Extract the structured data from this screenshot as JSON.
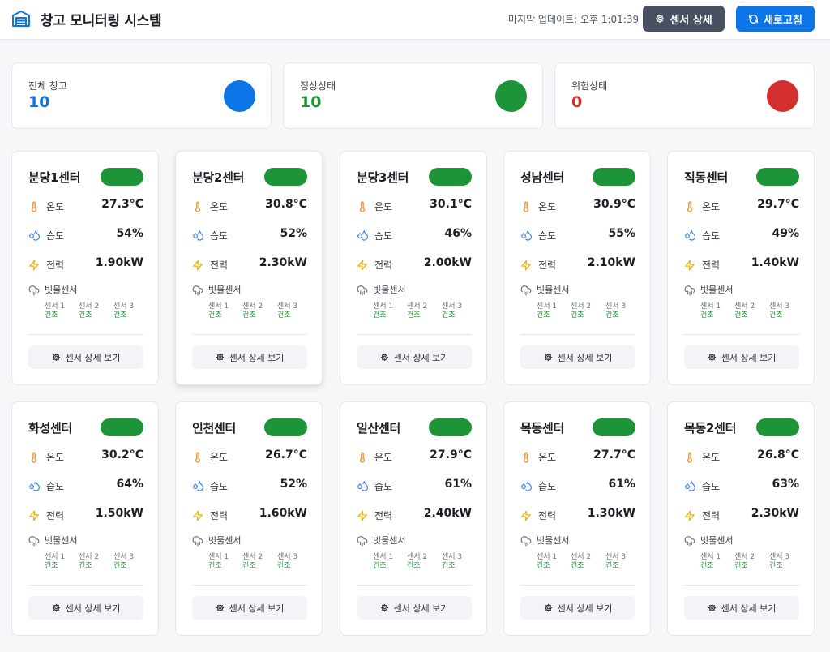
{
  "header": {
    "title": "창고 모니터링 시스템",
    "last_update": "마지막 업데이트: 오후 1:01:39",
    "sensor_detail_label": "센서 상세",
    "refresh_label": "새로고침",
    "icons": {
      "logo": "warehouse-icon",
      "sensor_detail": "gear-icon",
      "refresh": "refresh-icon"
    }
  },
  "stats": [
    {
      "label": "전체 창고",
      "value": "10",
      "color": "#0d74e7"
    },
    {
      "label": "정상상태",
      "value": "10",
      "color": "#1e9438"
    },
    {
      "label": "위험상태",
      "value": "0",
      "color": "#d32f2f"
    }
  ],
  "labels": {
    "temperature": "온도",
    "humidity": "습도",
    "power": "전력",
    "rain_sensor": "빗물센서",
    "view_detail": "센서 상세 보기"
  },
  "metric_icons": {
    "temperature": "thermometer-icon",
    "humidity": "droplets-icon",
    "power": "lightning-icon",
    "rain_sensor": "cloud-rain-icon",
    "view_detail": "gear-icon"
  },
  "status_colors": {
    "normal": "#1e9438",
    "dry": "#1e9438"
  },
  "warehouses": [
    {
      "name": "분당1센터",
      "temperature": "27.3°C",
      "humidity": "54%",
      "power": "1.90kW",
      "sensors": [
        {
          "name": "센서 1",
          "state": "건조"
        },
        {
          "name": "센서 2",
          "state": "건조"
        },
        {
          "name": "센서 3",
          "state": "건조"
        }
      ]
    },
    {
      "name": "분당2센터",
      "temperature": "30.8°C",
      "humidity": "52%",
      "power": "2.30kW",
      "sensors": [
        {
          "name": "센서 1",
          "state": "건조"
        },
        {
          "name": "센서 2",
          "state": "건조"
        },
        {
          "name": "센서 3",
          "state": "건조"
        }
      ]
    },
    {
      "name": "분당3센터",
      "temperature": "30.1°C",
      "humidity": "46%",
      "power": "2.00kW",
      "sensors": [
        {
          "name": "센서 1",
          "state": "건조"
        },
        {
          "name": "센서 2",
          "state": "건조"
        },
        {
          "name": "센서 3",
          "state": "건조"
        }
      ]
    },
    {
      "name": "성남센터",
      "temperature": "30.9°C",
      "humidity": "55%",
      "power": "2.10kW",
      "sensors": [
        {
          "name": "센서 1",
          "state": "건조"
        },
        {
          "name": "센서 2",
          "state": "건조"
        },
        {
          "name": "센서 3",
          "state": "건조"
        }
      ]
    },
    {
      "name": "직동센터",
      "temperature": "29.7°C",
      "humidity": "49%",
      "power": "1.40kW",
      "sensors": [
        {
          "name": "센서 1",
          "state": "건조"
        },
        {
          "name": "센서 2",
          "state": "건조"
        },
        {
          "name": "센서 3",
          "state": "건조"
        }
      ]
    },
    {
      "name": "화성센터",
      "temperature": "30.2°C",
      "humidity": "64%",
      "power": "1.50kW",
      "sensors": [
        {
          "name": "센서 1",
          "state": "건조"
        },
        {
          "name": "센서 2",
          "state": "건조"
        },
        {
          "name": "센서 3",
          "state": "건조"
        }
      ]
    },
    {
      "name": "인천센터",
      "temperature": "26.7°C",
      "humidity": "52%",
      "power": "1.60kW",
      "sensors": [
        {
          "name": "센서 1",
          "state": "건조"
        },
        {
          "name": "센서 2",
          "state": "건조"
        },
        {
          "name": "센서 3",
          "state": "건조"
        }
      ]
    },
    {
      "name": "일산센터",
      "temperature": "27.9°C",
      "humidity": "61%",
      "power": "2.40kW",
      "sensors": [
        {
          "name": "센서 1",
          "state": "건조"
        },
        {
          "name": "센서 2",
          "state": "건조"
        },
        {
          "name": "센서 3",
          "state": "건조"
        }
      ]
    },
    {
      "name": "목동센터",
      "temperature": "27.7°C",
      "humidity": "61%",
      "power": "1.30kW",
      "sensors": [
        {
          "name": "센서 1",
          "state": "건조"
        },
        {
          "name": "센서 2",
          "state": "건조"
        },
        {
          "name": "센서 3",
          "state": "건조"
        }
      ]
    },
    {
      "name": "목동2센터",
      "temperature": "26.8°C",
      "humidity": "63%",
      "power": "2.30kW",
      "sensors": [
        {
          "name": "센서 1",
          "state": "건조"
        },
        {
          "name": "센서 2",
          "state": "건조"
        },
        {
          "name": "센서 3",
          "state": "건조"
        }
      ]
    }
  ]
}
